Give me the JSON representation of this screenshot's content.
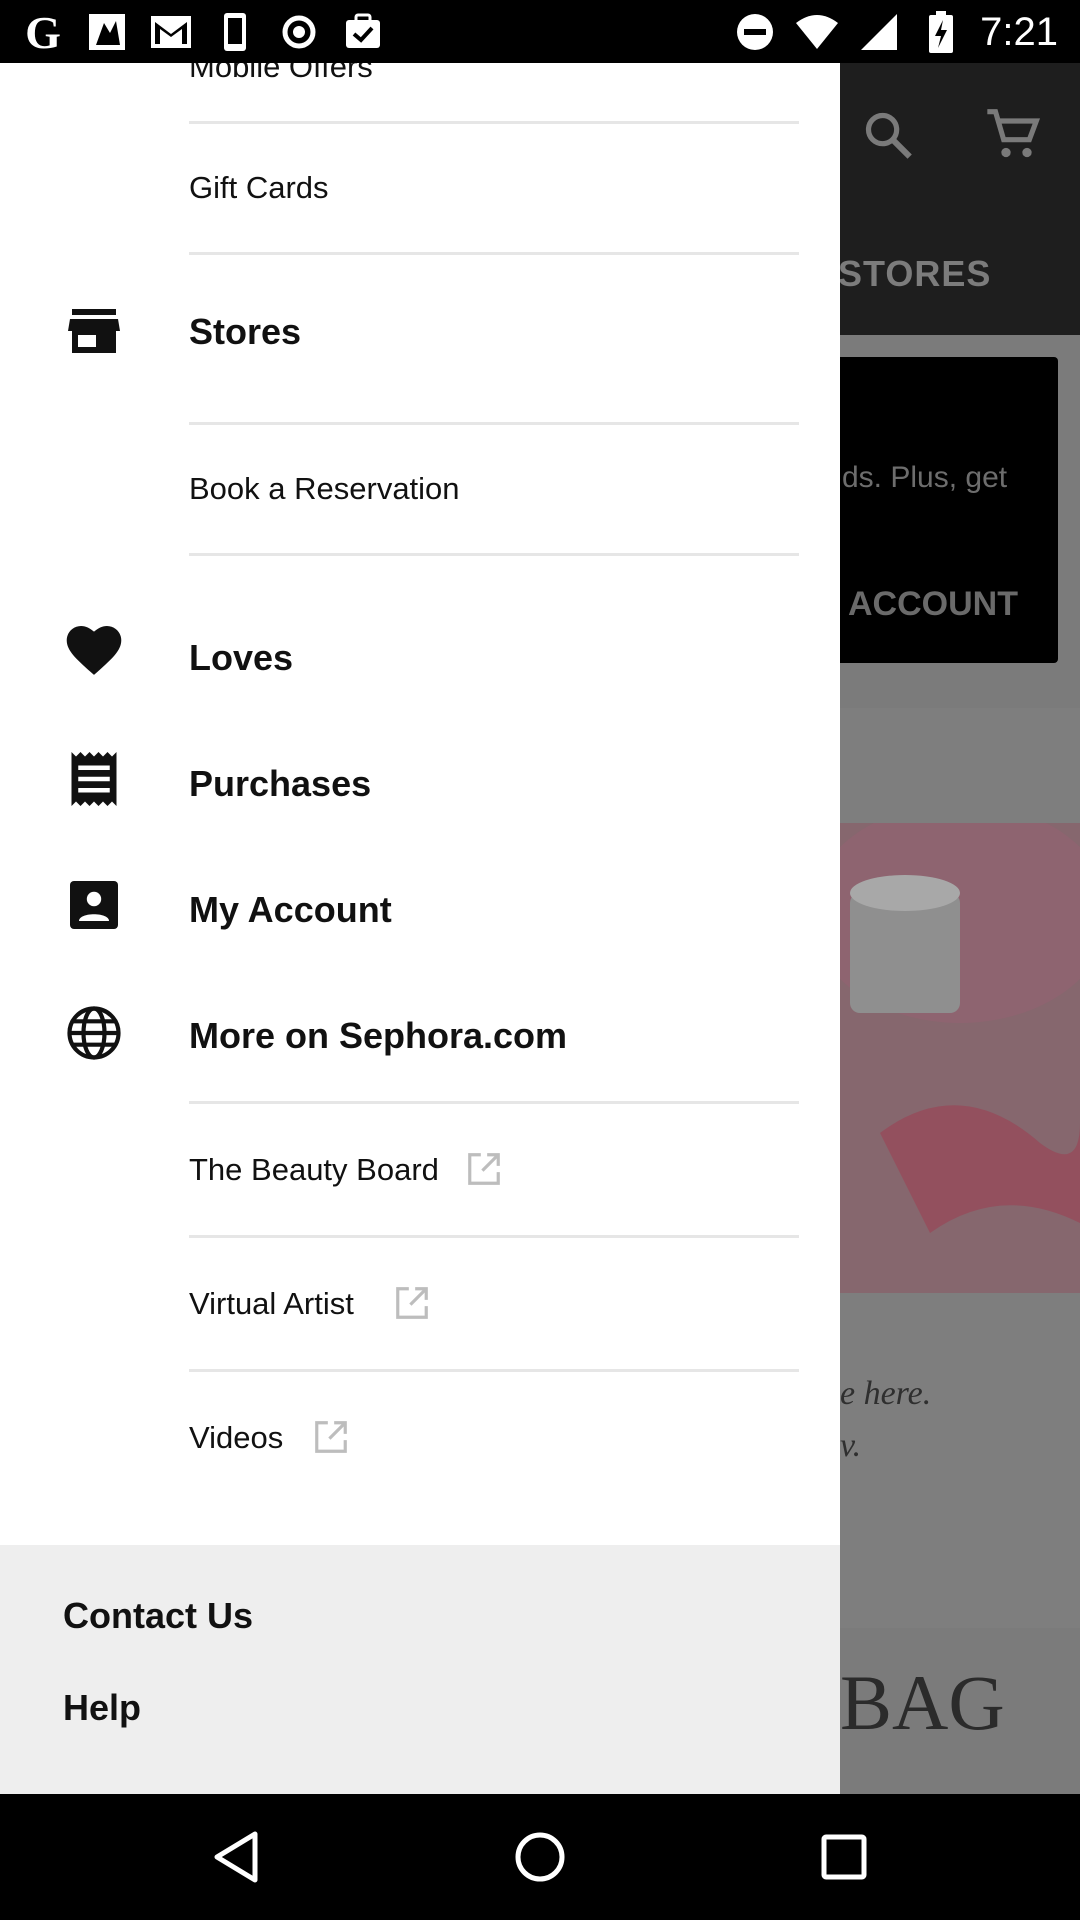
{
  "status_bar": {
    "time": "7:21",
    "left_icons": [
      "google-icon",
      "photo-notification-icon",
      "gmail-icon",
      "phone-icon",
      "record-icon",
      "task-icon"
    ],
    "right_icons": [
      "do-not-disturb-icon",
      "wifi-icon",
      "signal-icon",
      "battery-charging-icon"
    ]
  },
  "background_app": {
    "tab_label": "STORES",
    "card_text": "ds. Plus, get",
    "card_button": "ACCOUNT",
    "promo_line1": "e here.",
    "promo_line2": "v.",
    "bag_text": "BAG"
  },
  "drawer": {
    "partial_top_item": "Mobile Offers",
    "items": [
      {
        "label": "Gift Cards",
        "style": "sub"
      },
      {
        "label": "Stores",
        "style": "main",
        "icon": "store-icon"
      },
      {
        "label": "Book a Reservation",
        "style": "sub"
      },
      {
        "label": "Loves",
        "style": "main",
        "icon": "heart-icon"
      },
      {
        "label": "Purchases",
        "style": "main",
        "icon": "receipt-icon"
      },
      {
        "label": "My Account",
        "style": "main",
        "icon": "account-box-icon"
      },
      {
        "label": "More on Sephora.com",
        "style": "main",
        "icon": "globe-icon"
      },
      {
        "label": "The Beauty Board",
        "style": "sub",
        "external": true
      },
      {
        "label": "Virtual Artist",
        "style": "sub",
        "external": true
      },
      {
        "label": "Videos",
        "style": "sub",
        "external": true
      }
    ],
    "footer": {
      "contact": "Contact Us",
      "help": "Help"
    }
  },
  "nav_bar": {
    "buttons": [
      "back-icon",
      "home-icon",
      "recents-icon"
    ]
  },
  "colors": {
    "drawer_bg": "#ffffff",
    "footer_bg": "#eeeeee",
    "scrim": "#7b7b7b",
    "text": "#111111"
  }
}
